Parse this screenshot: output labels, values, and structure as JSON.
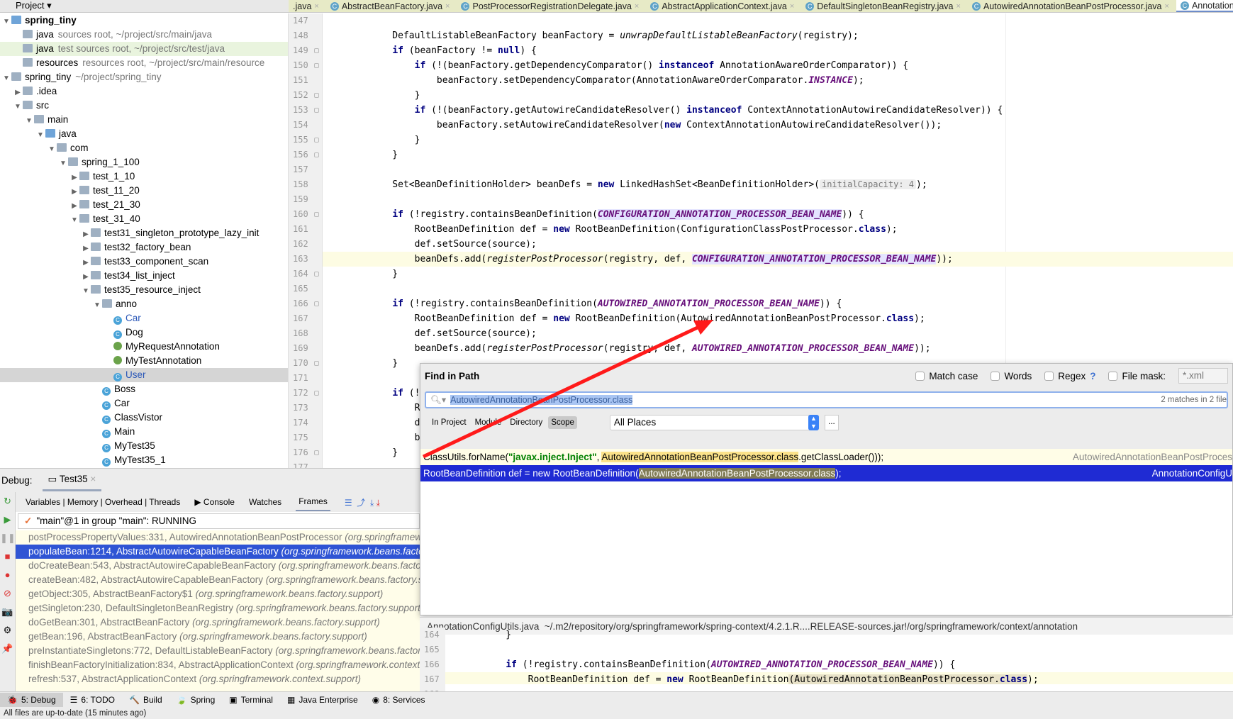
{
  "project_header": {
    "label": "Project ▾"
  },
  "editor_tabs": [
    {
      "label": ".java"
    },
    {
      "label": "AbstractBeanFactory.java"
    },
    {
      "label": "PostProcessorRegistrationDelegate.java"
    },
    {
      "label": "AbstractApplicationContext.java"
    },
    {
      "label": "DefaultSingletonBeanRegistry.java"
    },
    {
      "label": "AutowiredAnnotationBeanPostProcessor.java"
    },
    {
      "label": "AnnotationC",
      "active": true
    }
  ],
  "tree": [
    {
      "l": 0,
      "arr": "▼",
      "ic": "module",
      "name": "spring_tiny",
      "bold": true
    },
    {
      "l": 1,
      "ic": "fold",
      "name": "java",
      "extra": "sources root,  ~/project/src/main/java"
    },
    {
      "l": 1,
      "ic": "fold",
      "name": "java",
      "extra": "test sources root,  ~/project/src/test/java",
      "hl": true
    },
    {
      "l": 1,
      "ic": "fold",
      "name": "resources",
      "extra": "resources root,  ~/project/src/main/resource"
    },
    {
      "l": 0,
      "arr": "▼",
      "ic": "fold",
      "name": "spring_tiny",
      "extra": "~/project/spring_tiny"
    },
    {
      "l": 1,
      "arr": "▶",
      "ic": "fold",
      "name": ".idea"
    },
    {
      "l": 1,
      "arr": "▼",
      "ic": "fold",
      "name": "src"
    },
    {
      "l": 2,
      "arr": "▼",
      "ic": "fold",
      "name": "main"
    },
    {
      "l": 3,
      "arr": "▼",
      "ic": "foldb",
      "name": "java"
    },
    {
      "l": 4,
      "arr": "▼",
      "ic": "fold",
      "name": "com"
    },
    {
      "l": 5,
      "arr": "▼",
      "ic": "fold",
      "name": "spring_1_100"
    },
    {
      "l": 6,
      "arr": "▶",
      "ic": "fold",
      "name": "test_1_10"
    },
    {
      "l": 6,
      "arr": "▶",
      "ic": "fold",
      "name": "test_11_20"
    },
    {
      "l": 6,
      "arr": "▶",
      "ic": "fold",
      "name": "test_21_30"
    },
    {
      "l": 6,
      "arr": "▼",
      "ic": "fold",
      "name": "test_31_40"
    },
    {
      "l": 7,
      "arr": "▶",
      "ic": "fold",
      "name": "test31_singleton_prototype_lazy_init"
    },
    {
      "l": 7,
      "arr": "▶",
      "ic": "fold",
      "name": "test32_factory_bean"
    },
    {
      "l": 7,
      "arr": "▶",
      "ic": "fold",
      "name": "test33_component_scan"
    },
    {
      "l": 7,
      "arr": "▶",
      "ic": "fold",
      "name": "test34_list_inject"
    },
    {
      "l": 7,
      "arr": "▼",
      "ic": "fold",
      "name": "test35_resource_inject"
    },
    {
      "l": 8,
      "arr": "▼",
      "ic": "fold",
      "name": "anno"
    },
    {
      "l": 9,
      "ic": "class",
      "name": "Car",
      "blue": true
    },
    {
      "l": 9,
      "ic": "class",
      "name": "Dog"
    },
    {
      "l": 9,
      "ic": "ann",
      "name": "MyRequestAnnotation"
    },
    {
      "l": 9,
      "ic": "ann",
      "name": "MyTestAnnotation"
    },
    {
      "l": 9,
      "ic": "class",
      "name": "User",
      "blue": true,
      "sel": true
    },
    {
      "l": 8,
      "ic": "class",
      "name": "Boss"
    },
    {
      "l": 8,
      "ic": "class",
      "name": "Car"
    },
    {
      "l": 8,
      "ic": "class",
      "name": "ClassVistor"
    },
    {
      "l": 8,
      "ic": "class",
      "name": "Main"
    },
    {
      "l": 8,
      "ic": "class",
      "name": "MyTest35"
    },
    {
      "l": 8,
      "ic": "class",
      "name": "MyTest35_1"
    }
  ],
  "editor": {
    "first_line": 147,
    "current_line": 163,
    "lines": [
      [],
      [
        [
          "    DefaultListableBeanFactory beanFactory = ",
          ""
        ],
        [
          "unwrapDefaultListableBeanFactory",
          "it"
        ],
        [
          "(registry);",
          ""
        ]
      ],
      [
        [
          "    ",
          ""
        ],
        [
          "if",
          "kw"
        ],
        [
          " (beanFactory != ",
          ""
        ],
        [
          "null",
          "kw"
        ],
        [
          ") {",
          ""
        ]
      ],
      [
        [
          "        ",
          ""
        ],
        [
          "if",
          "kw"
        ],
        [
          " (!(beanFactory.getDependencyComparator() ",
          ""
        ],
        [
          "instanceof",
          "kw"
        ],
        [
          " AnnotationAwareOrderComparator)) {",
          ""
        ]
      ],
      [
        [
          "            beanFactory.setDependencyComparator(AnnotationAwareOrderComparator.",
          ""
        ],
        [
          "INSTANCE",
          "cn"
        ],
        [
          ");",
          ""
        ]
      ],
      [
        [
          "        }",
          ""
        ]
      ],
      [
        [
          "        ",
          ""
        ],
        [
          "if",
          "kw"
        ],
        [
          " (!(beanFactory.getAutowireCandidateResolver() ",
          ""
        ],
        [
          "instanceof",
          "kw"
        ],
        [
          " ContextAnnotationAutowireCandidateResolver)) {",
          ""
        ]
      ],
      [
        [
          "            beanFactory.setAutowireCandidateResolver(",
          ""
        ],
        [
          "new",
          "kw"
        ],
        [
          " ContextAnnotationAutowireCandidateResolver());",
          ""
        ]
      ],
      [
        [
          "        }",
          ""
        ]
      ],
      [
        [
          "    }",
          ""
        ]
      ],
      [],
      [
        [
          "    Set<BeanDefinitionHolder> beanDefs = ",
          ""
        ],
        [
          "new",
          "kw"
        ],
        [
          " LinkedHashSet<BeanDefinitionHolder>(",
          ""
        ],
        [
          "initialCapacity: 4",
          "hint"
        ],
        [
          ");",
          ""
        ]
      ],
      [],
      [
        [
          "    ",
          ""
        ],
        [
          "if",
          "kw"
        ],
        [
          " (!registry.containsBeanDefinition(",
          ""
        ],
        [
          "CONFIGURATION_ANNOTATION_PROCESSOR_BEAN_NAME",
          "cn hlc"
        ],
        [
          ")) {",
          ""
        ]
      ],
      [
        [
          "        RootBeanDefinition def = ",
          ""
        ],
        [
          "new",
          "kw"
        ],
        [
          " RootBeanDefinition(ConfigurationClassPostProcessor.",
          ""
        ],
        [
          "class",
          "kw"
        ],
        [
          ");",
          ""
        ]
      ],
      [
        [
          "        def.setSource(source);",
          ""
        ]
      ],
      [
        [
          "        beanDefs.add(",
          ""
        ],
        [
          "registerPostProcessor",
          "it"
        ],
        [
          "(registry, def, ",
          ""
        ],
        [
          "CONFIGURATION_ANNOTATION_PROCESSOR_BEAN_NAME",
          "cn hlc"
        ],
        [
          "));",
          ""
        ]
      ],
      [
        [
          "    }",
          ""
        ]
      ],
      [],
      [
        [
          "    ",
          ""
        ],
        [
          "if",
          "kw"
        ],
        [
          " (!registry.containsBeanDefinition(",
          ""
        ],
        [
          "AUTOWIRED_ANNOTATION_PROCESSOR_BEAN_NAME",
          "cn"
        ],
        [
          ")) {",
          ""
        ]
      ],
      [
        [
          "        RootBeanDefinition def = ",
          ""
        ],
        [
          "new",
          "kw"
        ],
        [
          " RootBeanDefinition(AutowiredAnnotationBeanPostProcessor.",
          ""
        ],
        [
          "class",
          "kw"
        ],
        [
          ");",
          ""
        ]
      ],
      [
        [
          "        def.setSource(source);",
          ""
        ]
      ],
      [
        [
          "        beanDefs.add(",
          ""
        ],
        [
          "registerPostProcessor",
          "it"
        ],
        [
          "(registry, def, ",
          ""
        ],
        [
          "AUTOWIRED_ANNOTATION_PROCESSOR_BEAN_NAME",
          "cn"
        ],
        [
          "));",
          ""
        ]
      ],
      [
        [
          "    }",
          ""
        ]
      ],
      [],
      [
        [
          "    ",
          ""
        ],
        [
          "if",
          "kw"
        ],
        [
          " (!regi",
          ""
        ]
      ],
      [
        [
          "        RootB",
          ""
        ]
      ],
      [
        [
          "        def.s",
          ""
        ]
      ],
      [
        [
          "        beanD",
          ""
        ]
      ],
      [
        [
          "    }",
          ""
        ]
      ],
      []
    ]
  },
  "find": {
    "title": "Find in Path",
    "match_case": "Match case",
    "words": "Words",
    "regex": "Regex",
    "regex_help": "?",
    "file_mask_label": "File mask:",
    "file_mask_value": "*.xml",
    "query": "AutowiredAnnotationBeanPostProcessor.class",
    "match_count": "2 matches in 2 file",
    "scopes": [
      "In Project",
      "Module",
      "Directory",
      "Scope"
    ],
    "active_scope": "Scope",
    "places": "All Places",
    "more": "...",
    "results": [
      {
        "pre": "ClassUtils.forName(",
        "str": "\"javax.inject.Inject\"",
        "mid": ", ",
        "match": "AutowiredAnnotationBeanPostProcessor.class",
        "post": ".getClassLoader()));",
        "file": "AutowiredAnnotationBeanPostProces"
      },
      {
        "pre": "RootBeanDefinition def = new RootBeanDefinition(",
        "str": "",
        "mid": "",
        "match": "AutowiredAnnotationBeanPostProcessor.class",
        "post": ");",
        "file": "AnnotationConfigU",
        "selected": true
      }
    ],
    "preview_file": "AnnotationConfigUtils.java",
    "preview_path": "~/.m2/repository/org/springframework/spring-context/4.2.1.R....RELEASE-sources.jar!/org/springframework/context/annotation",
    "preview_first_line": 164,
    "preview_lines": [
      [
        [
          "    }",
          ""
        ]
      ],
      [],
      [
        [
          "    ",
          ""
        ],
        [
          "if",
          "kw"
        ],
        [
          " (!registry.containsBeanDefinition(",
          ""
        ],
        [
          "AUTOWIRED_ANNOTATION_PROCESSOR_BEAN_NAME",
          "cn"
        ],
        [
          ")) {",
          ""
        ]
      ],
      [
        [
          "        RootBeanDefinition def = ",
          ""
        ],
        [
          "new",
          "kw"
        ],
        [
          " RootBeanDefinition",
          ""
        ],
        [
          "(AutowiredAnnotationBeanPostProcessor.",
          "mhl"
        ],
        [
          "class",
          "kw mhl"
        ],
        [
          ")",
          ""
        ],
        [
          ";",
          ""
        ]
      ],
      [
        [
          "        def.setSource(source);",
          ""
        ]
      ]
    ],
    "preview_current": 167
  },
  "debug": {
    "label": "Debug:",
    "session": "Test35",
    "tabs": [
      "Variables | Memory | Overhead | Threads",
      "Console",
      "Watches",
      "Frames"
    ],
    "thread": "\"main\"@1 in group \"main\": RUNNING",
    "frames": [
      {
        "m": "postProcessPropertyValues:331, AutowiredAnnotationBeanPostProcessor ",
        "p": "(org.springframework.beans.factory.annotation)"
      },
      {
        "m": "populateBean:1214, AbstractAutowireCapableBeanFactory ",
        "p": "(org.springframework.beans.factory.support)",
        "sel": true
      },
      {
        "m": "doCreateBean:543, AbstractAutowireCapableBeanFactory ",
        "p": "(org.springframework.beans.factory.support)"
      },
      {
        "m": "createBean:482, AbstractAutowireCapableBeanFactory ",
        "p": "(org.springframework.beans.factory.support)"
      },
      {
        "m": "getObject:305, AbstractBeanFactory$1 ",
        "p": "(org.springframework.beans.factory.support)"
      },
      {
        "m": "getSingleton:230, DefaultSingletonBeanRegistry ",
        "p": "(org.springframework.beans.factory.support)"
      },
      {
        "m": "doGetBean:301, AbstractBeanFactory ",
        "p": "(org.springframework.beans.factory.support)"
      },
      {
        "m": "getBean:196, AbstractBeanFactory ",
        "p": "(org.springframework.beans.factory.support)"
      },
      {
        "m": "preInstantiateSingletons:772, DefaultListableBeanFactory ",
        "p": "(org.springframework.beans.factory.support)"
      },
      {
        "m": "finishBeanFactoryInitialization:834, AbstractApplicationContext ",
        "p": "(org.springframework.context.support)"
      },
      {
        "m": "refresh:537, AbstractApplicationContext ",
        "p": "(org.springframework.context.support)"
      }
    ]
  },
  "bottom_tools": [
    {
      "icon": "🐞",
      "label": "5: Debug",
      "active": true
    },
    {
      "icon": "☰",
      "label": "6: TODO"
    },
    {
      "icon": "🔨",
      "label": "Build"
    },
    {
      "icon": "🍃",
      "label": "Spring"
    },
    {
      "icon": "▣",
      "label": "Terminal"
    },
    {
      "icon": "▦",
      "label": "Java Enterprise"
    },
    {
      "icon": "◉",
      "label": "8: Services"
    }
  ],
  "status": "All files are up-to-date (15 minutes ago)",
  "colors": {
    "selection": "#1f2bd3",
    "frame_selection": "#2f54d4",
    "annotation_arrow": "#ff0000",
    "current_line": "#fdfce3"
  }
}
